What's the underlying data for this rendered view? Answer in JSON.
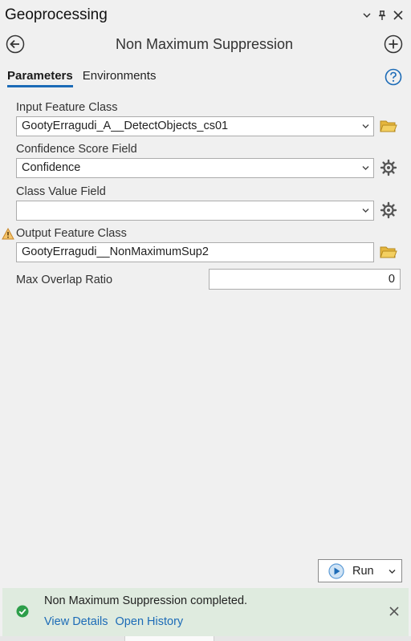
{
  "pane": {
    "title": "Geoprocessing"
  },
  "tool": {
    "title": "Non Maximum Suppression"
  },
  "tabs": [
    {
      "label": "Parameters"
    },
    {
      "label": "Environments"
    }
  ],
  "params": {
    "input_feature_class": {
      "label": "Input Feature Class",
      "value": "GootyErragudi_A__DetectObjects_cs01"
    },
    "confidence_score_field": {
      "label": "Confidence Score Field",
      "value": "Confidence"
    },
    "class_value_field": {
      "label": "Class Value Field",
      "value": ""
    },
    "output_feature_class": {
      "label": "Output Feature Class",
      "value": "GootyErragudi__NonMaximumSup2"
    },
    "max_overlap_ratio": {
      "label": "Max Overlap Ratio",
      "value": "0"
    }
  },
  "run": {
    "label": "Run"
  },
  "message": {
    "text": "Non Maximum Suppression completed.",
    "view_details": "View Details",
    "open_history": "Open History"
  },
  "colors": {
    "accent": "#1c6bb7",
    "success": "#2d9e4a",
    "message_bg": "#dfebdf",
    "warning": "#e8a33a"
  }
}
